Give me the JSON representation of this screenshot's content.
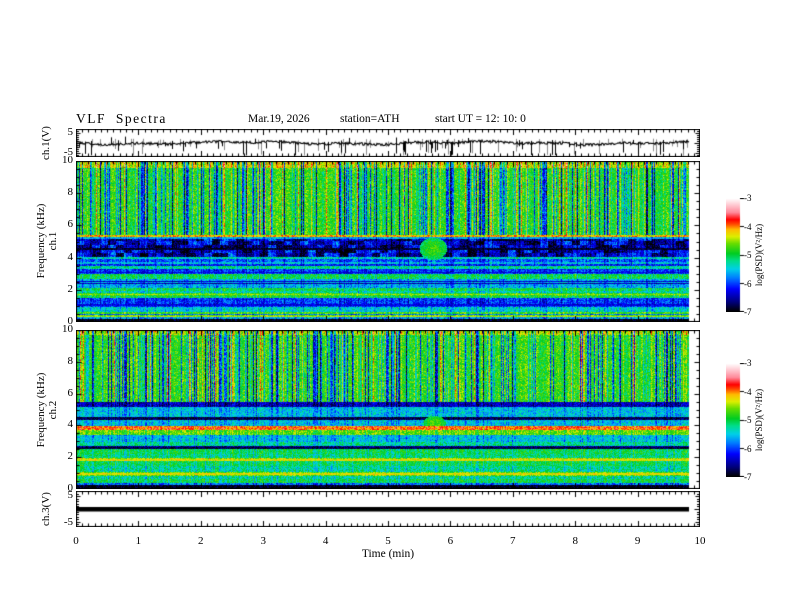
{
  "header": {
    "title": "VLF  Spectra",
    "date": "Mar.19, 2026",
    "station": "station=ATH",
    "start_ut": "start UT =  12: 10: 0"
  },
  "axes": {
    "time_label": "Time  (min)",
    "time_ticks": [
      "0",
      "1",
      "2",
      "3",
      "4",
      "5",
      "6",
      "7",
      "8",
      "9",
      "10"
    ],
    "freq_ticks": [
      "10",
      "8",
      "6",
      "4",
      "2",
      "0"
    ],
    "volt_ticks_top": [
      "5",
      "-5"
    ],
    "volt_ticks_bottom": [
      "5",
      "-5"
    ],
    "ch1_wave_label": "ch.1(V)",
    "spec1_channel": "ch.1",
    "spec2_channel": "ch.2",
    "freq_axis_label": "Frequency  (kHz)",
    "ch3_wave_label": "ch.3(V)"
  },
  "colorbar": {
    "label": "log(PSD)(V²/Hz)",
    "ticks": [
      "-3",
      "-4",
      "-5",
      "-6",
      "-7"
    ]
  },
  "colormap": [
    [
      -7.0,
      "#000000"
    ],
    [
      -6.65,
      "#000080"
    ],
    [
      -6.2,
      "#0000ff"
    ],
    [
      -5.8,
      "#0080ff"
    ],
    [
      -5.5,
      "#00d0e8"
    ],
    [
      -5.2,
      "#00dd88"
    ],
    [
      -4.95,
      "#00cc22"
    ],
    [
      -4.6,
      "#66dd00"
    ],
    [
      -4.35,
      "#ddee00"
    ],
    [
      -4.1,
      "#ffbb00"
    ],
    [
      -3.9,
      "#ff4400"
    ],
    [
      -3.75,
      "#ff0000"
    ],
    [
      -3.5,
      "#ff8899"
    ],
    [
      -3.2,
      "#ffd0d8"
    ],
    [
      -3.0,
      "#ffffff"
    ]
  ],
  "chart_data": [
    {
      "type": "line",
      "name": "ch.1 time series",
      "ylabel": "ch.1(V)",
      "xlim": [
        0,
        10
      ],
      "ylim": [
        -7,
        7
      ],
      "baseline_v": 0,
      "noise_amplitude_v": 1.2,
      "spike_depth_v": [
        -2,
        -6.5
      ],
      "data_end_min": 9.83
    },
    {
      "type": "heatmap",
      "name": "ch.1 spectrogram",
      "channel": "ch.1",
      "xlabel": "Time (min)",
      "ylabel": "Frequency (kHz)",
      "xlim": [
        0,
        10
      ],
      "ylim": [
        0,
        10
      ],
      "zlabel": "log(PSD)(V²/Hz)",
      "zlim": [
        -7,
        -3
      ],
      "data_end_min": 9.83,
      "bands": [
        [
          0,
          0.18,
          -7
        ],
        [
          0.18,
          0.3,
          -5.6
        ],
        [
          0.3,
          0.42,
          -4.6
        ],
        [
          0.42,
          0.52,
          -5.8
        ],
        [
          0.52,
          0.62,
          -4.7
        ],
        [
          0.62,
          0.95,
          -5.4
        ],
        [
          0.95,
          1.5,
          -6
        ],
        [
          1.5,
          1.62,
          -5
        ],
        [
          1.62,
          1.78,
          -4.8
        ],
        [
          1.78,
          1.95,
          -5.3
        ],
        [
          1.95,
          2.1,
          -5
        ],
        [
          2.1,
          2.65,
          -5.6
        ],
        [
          2.65,
          3,
          -5
        ],
        [
          3,
          3.3,
          -6
        ],
        [
          3.3,
          3.45,
          -5.2
        ],
        [
          3.45,
          3.6,
          -6.1
        ],
        [
          3.6,
          3.75,
          -5.5
        ],
        [
          3.75,
          3.9,
          -5.9
        ],
        [
          3.9,
          4.05,
          -5.3
        ],
        [
          4.05,
          5.15,
          -6.4
        ],
        [
          5.15,
          5.28,
          -5.6
        ],
        [
          5.28,
          5.42,
          -4.2
        ],
        [
          5.42,
          9.55,
          -4.85
        ],
        [
          9.55,
          10,
          -4.35
        ]
      ],
      "lines": [
        [
          1.05,
          -6.3
        ],
        [
          2.38,
          -6.5
        ],
        [
          2.52,
          -6.4
        ],
        [
          3.08,
          -6.3
        ],
        [
          4.52,
          -6.9
        ],
        [
          0.35,
          -4.4
        ],
        [
          1.7,
          -4.5
        ]
      ],
      "dotline": {
        "f0": 5.28,
        "f1": 5.4,
        "v": -4.1
      },
      "blocky": {
        "f0": 4.05,
        "f1": 5.15
      },
      "streaks": {
        "f_min": 5.42,
        "dark_p": 0.3,
        "bright_p": 0.12
      },
      "blob": {
        "t": 5.72,
        "f": 4.55,
        "rt": 0.22,
        "rf": 0.7,
        "v": -4.75
      }
    },
    {
      "type": "heatmap",
      "name": "ch.2 spectrogram",
      "channel": "ch.2",
      "xlabel": "Time (min)",
      "ylabel": "Frequency (kHz)",
      "xlim": [
        0,
        10
      ],
      "ylim": [
        0,
        10
      ],
      "zlabel": "log(PSD)(V²/Hz)",
      "zlim": [
        -7,
        -3
      ],
      "data_end_min": 9.83,
      "bands": [
        [
          0,
          0.14,
          -7
        ],
        [
          0.14,
          0.25,
          -6.6
        ],
        [
          0.25,
          0.4,
          -5.8
        ],
        [
          0.4,
          0.62,
          -5
        ],
        [
          0.62,
          0.8,
          -5.2
        ],
        [
          0.8,
          1.05,
          -4.6
        ],
        [
          1.05,
          1.45,
          -5.2
        ],
        [
          1.45,
          1.75,
          -5
        ],
        [
          1.75,
          1.92,
          -4.4
        ],
        [
          1.92,
          2.2,
          -5.1
        ],
        [
          2.2,
          2.52,
          -5
        ],
        [
          2.52,
          2.72,
          -6.5
        ],
        [
          2.72,
          2.95,
          -5.2
        ],
        [
          2.95,
          3.4,
          -5.5
        ],
        [
          3.4,
          3.72,
          -4.6
        ],
        [
          3.72,
          3.95,
          -3.9
        ],
        [
          3.95,
          4.35,
          -5.5
        ],
        [
          4.35,
          4.55,
          -6.7
        ],
        [
          4.55,
          5.15,
          -5.5
        ],
        [
          5.15,
          5.5,
          -6.4
        ],
        [
          5.5,
          9.7,
          -4.8
        ],
        [
          9.7,
          10,
          -4.4
        ]
      ],
      "lines": [
        [
          0.2,
          -6.9
        ],
        [
          2.58,
          -6.8
        ],
        [
          4.45,
          -6.8
        ],
        [
          0.95,
          -4.3
        ],
        [
          1.82,
          -4.3
        ]
      ],
      "dotline": {
        "f0": 3.76,
        "f1": 3.92,
        "v": -3.85
      },
      "streaks": {
        "f_min": 5.5,
        "dark_p": 0.33,
        "bright_p": 0.1
      },
      "blob": {
        "t": 5.74,
        "f": 4.15,
        "rt": 0.18,
        "rf": 0.45,
        "v": -4.7
      }
    },
    {
      "type": "line",
      "name": "ch.3 time series",
      "ylabel": "ch.3(V)",
      "xlim": [
        0,
        10
      ],
      "ylim": [
        -7,
        7
      ],
      "constant_value": 0,
      "data_end_min": 9.83
    }
  ]
}
